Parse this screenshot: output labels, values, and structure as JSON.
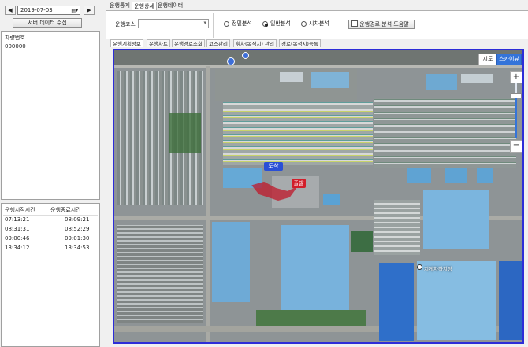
{
  "left": {
    "prev": "◀",
    "date": "2019-07-03",
    "next": "▶",
    "collect_btn": "서버 데이터 수집",
    "vehicle_header": "차량번호",
    "vehicles": [
      "000000"
    ],
    "trip_headers": {
      "start": "운행시작시간",
      "end": "운행종료시간"
    },
    "trips": [
      {
        "start": "07:13:21",
        "end": "08:09:21"
      },
      {
        "start": "08:31:31",
        "end": "08:52:29"
      },
      {
        "start": "09:00:46",
        "end": "09:01:30"
      },
      {
        "start": "13:34:12",
        "end": "13:34:53"
      }
    ]
  },
  "tabs": [
    "운행통계",
    "운행상세",
    "운행데이터"
  ],
  "filter": {
    "course_label": "운행코스",
    "course_value": "",
    "options": [
      "정밀분석",
      "일반분석",
      "시차분석"
    ],
    "selected": "일반분석",
    "help_btn": "운행경로 분석 도움말"
  },
  "subtabs": [
    "운행계획정보",
    "운행차트",
    "운행경로조회",
    "코스관리",
    "휘차(목적지) 관리",
    "경로(목적지)등록"
  ],
  "map": {
    "type_buttons": [
      "지도",
      "스카이뷰"
    ],
    "active_type": "스카이뷰",
    "zoom_in": "+",
    "zoom_out": "−",
    "arrive_label": "도착",
    "depart_label": "출발",
    "place_label": "지게차하치장"
  },
  "colors": {
    "accent": "#2d2dd8",
    "marker_arrive": "#2a4fd6",
    "marker_depart": "#d21e2a",
    "route": "#c0182a"
  }
}
